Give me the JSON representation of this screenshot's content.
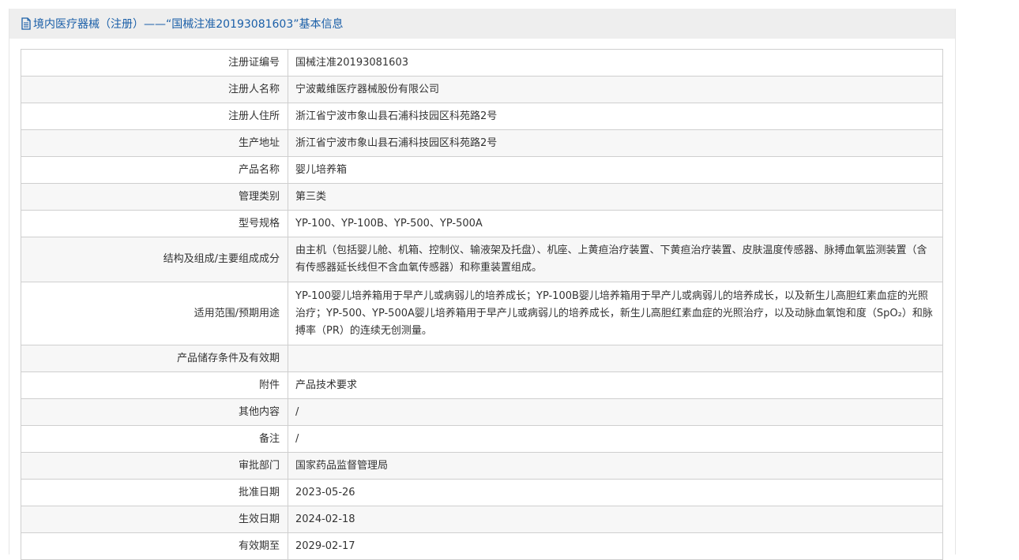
{
  "header": {
    "title": "境内医疗器械（注册）——“国械注准20193081603”基本信息",
    "icon": "document-icon",
    "title_color": "#1a5fa8"
  },
  "rows": [
    {
      "label": "注册证编号",
      "value": "国械注准20193081603"
    },
    {
      "label": "注册人名称",
      "value": "宁波戴维医疗器械股份有限公司"
    },
    {
      "label": "注册人住所",
      "value": "浙江省宁波市象山县石浦科技园区科苑路2号"
    },
    {
      "label": "生产地址",
      "value": "浙江省宁波市象山县石浦科技园区科苑路2号"
    },
    {
      "label": "产品名称",
      "value": "婴儿培养箱"
    },
    {
      "label": "管理类别",
      "value": "第三类"
    },
    {
      "label": "型号规格",
      "value": "YP-100、YP-100B、YP-500、YP-500A"
    },
    {
      "label": "结构及组成/主要组成成分",
      "value": "由主机（包括婴儿舱、机箱、控制仪、输液架及托盘）、机座、上黄疸治疗装置、下黄疸治疗装置、皮肤温度传感器、脉搏血氧监测装置（含有传感器延长线但不含血氧传感器）和称重装置组成。"
    },
    {
      "label": "适用范围/预期用途",
      "value": "YP-100婴儿培养箱用于早产儿或病弱儿的培养成长；YP-100B婴儿培养箱用于早产儿或病弱儿的培养成长，以及新生儿高胆红素血症的光照治疗；YP-500、YP-500A婴儿培养箱用于早产儿或病弱儿的培养成长，新生儿高胆红素血症的光照治疗，以及动脉血氧饱和度（SpO₂）和脉搏率（PR）的连续无创测量。"
    },
    {
      "label": "产品储存条件及有效期",
      "value": ""
    },
    {
      "label": "附件",
      "value": "产品技术要求"
    },
    {
      "label": "其他内容",
      "value": "/"
    },
    {
      "label": "备注",
      "value": "/"
    },
    {
      "label": "审批部门",
      "value": "国家药品监督管理局"
    },
    {
      "label": "批准日期",
      "value": "2023-05-26"
    },
    {
      "label": "生效日期",
      "value": "2024-02-18"
    },
    {
      "label": "有效期至",
      "value": "2029-02-17"
    }
  ]
}
